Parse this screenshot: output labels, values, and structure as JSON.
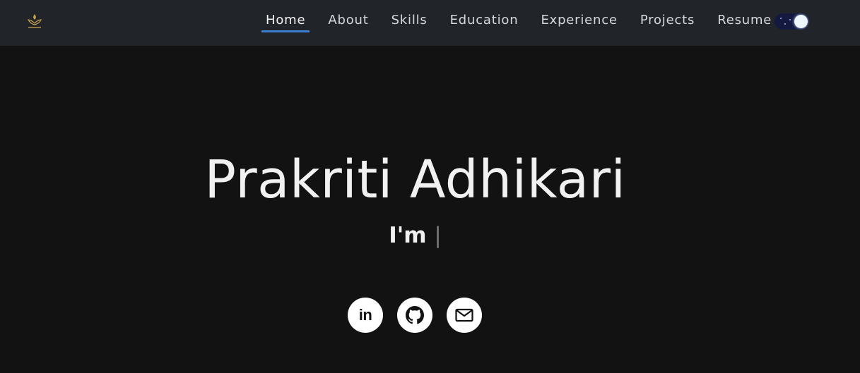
{
  "nav": {
    "items": [
      {
        "label": "Home",
        "active": true
      },
      {
        "label": "About",
        "active": false
      },
      {
        "label": "Skills",
        "active": false
      },
      {
        "label": "Education",
        "active": false
      },
      {
        "label": "Experience",
        "active": false
      },
      {
        "label": "Projects",
        "active": false
      },
      {
        "label": "Resume",
        "active": false
      }
    ],
    "active_color": "#3d7fd1",
    "theme_toggle": {
      "icon": "moon-toggle-icon",
      "state": "dark"
    }
  },
  "hero": {
    "name": "Prakriti Adhikari",
    "tagline_prefix": "I'm",
    "cursor": "|"
  },
  "socials": [
    {
      "name": "linkedin",
      "icon": "linkedin-icon",
      "text": "in"
    },
    {
      "name": "github",
      "icon": "github-icon"
    },
    {
      "name": "email",
      "icon": "mail-icon"
    }
  ],
  "colors": {
    "background": "#121212",
    "navbar": "#212429",
    "accent": "#3d7fd1"
  }
}
